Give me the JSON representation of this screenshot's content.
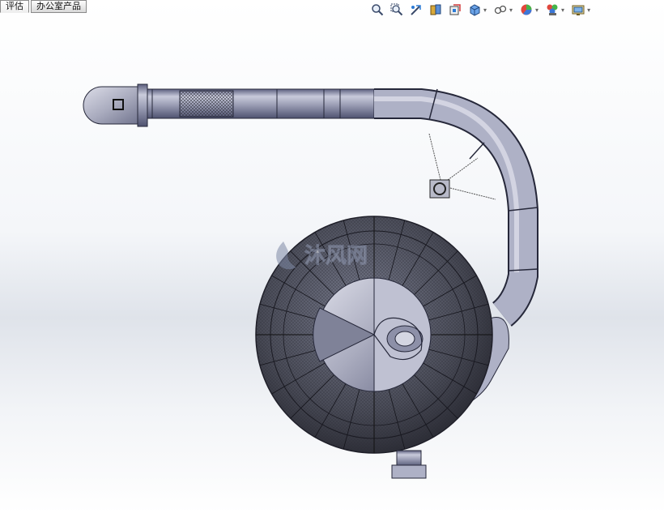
{
  "tabs": [
    {
      "label": "评估",
      "active": true
    },
    {
      "label": "办公室产品",
      "active": false
    }
  ],
  "heads_up_toolbar": [
    {
      "name": "zoom-to-fit-icon"
    },
    {
      "name": "zoom-to-area-icon"
    },
    {
      "name": "previous-view-icon"
    },
    {
      "name": "section-view-icon"
    },
    {
      "name": "dynamic-annotation-view-icon"
    },
    {
      "name": "view-orientation-icon",
      "dropdown": true
    },
    {
      "name": "display-style-icon",
      "dropdown": true
    },
    {
      "name": "hide-show-items-icon",
      "dropdown": true
    },
    {
      "name": "edit-appearance-icon",
      "dropdown": true
    },
    {
      "name": "apply-scene-icon",
      "dropdown": true
    },
    {
      "name": "view-settings-icon",
      "dropdown": true
    }
  ],
  "watermark": {
    "text": "沐风网"
  },
  "colors": {
    "part": "#aeb1c6",
    "part_dark": "#6c7090",
    "mesh": "#3c3d46",
    "edge": "#1e1e28"
  }
}
